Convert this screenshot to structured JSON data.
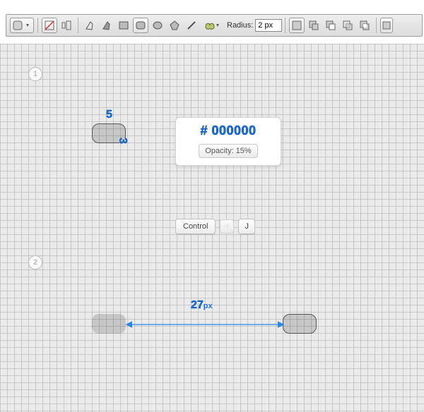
{
  "toolbar": {
    "shape_menu": "shape-menu",
    "radius_label": "Radius:",
    "radius_value": "2 px"
  },
  "popup": {
    "hex": "# 000000",
    "opacity": "Opacity: 15%"
  },
  "shortcut": {
    "key1": "Control",
    "plus": "+",
    "key2": "J"
  },
  "step1": {
    "badge": "1",
    "w_label": "5",
    "h_label": "3"
  },
  "step2": {
    "badge": "2",
    "distance": "27",
    "distance_unit": "px"
  }
}
